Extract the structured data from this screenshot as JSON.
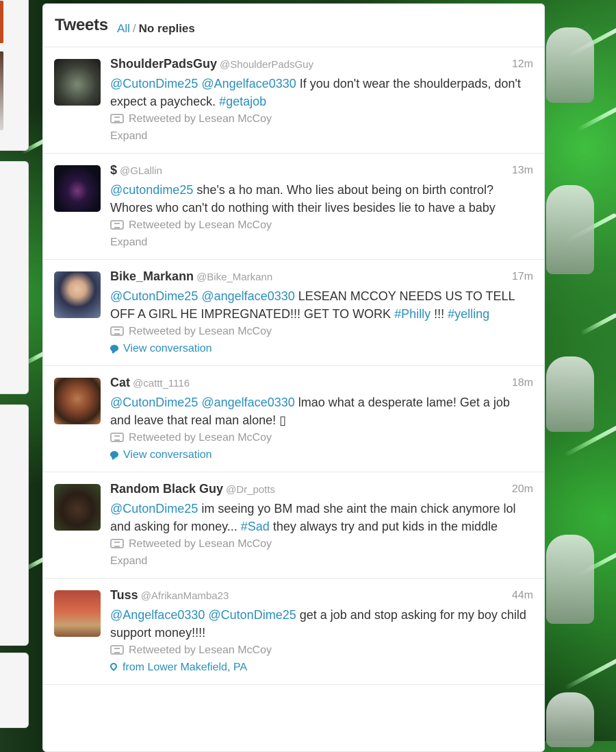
{
  "header": {
    "title": "Tweets",
    "link_all": "All",
    "separator": "/",
    "link_no_replies": "No replies"
  },
  "left_panel": {
    "close_glyph": "×"
  },
  "icons": {
    "retweet": "retweet-icon",
    "conversation": "speech-bubble-icon",
    "location": "map-pin-icon",
    "dismiss": "close-icon"
  },
  "colors": {
    "link": "#2a8fbd",
    "text": "#333333",
    "muted": "#999999"
  },
  "tweets": [
    {
      "name": "ShoulderPadsGuy",
      "handle": "@ShoulderPadsGuy",
      "time": "12m",
      "text_parts": [
        {
          "t": "@CutonDime25",
          "hl": true
        },
        {
          "t": " ",
          "hl": false
        },
        {
          "t": "@Angelface0330",
          "hl": true
        },
        {
          "t": " If you don't wear the shoulderpads, don't expect a paycheck. ",
          "hl": false
        },
        {
          "t": "#getajob",
          "hl": true
        }
      ],
      "retweeted_by": "Retweeted by Lesean McCoy",
      "action": "Expand",
      "action_type": "expand"
    },
    {
      "name": "$",
      "handle": "@GLallin",
      "time": "13m",
      "text_parts": [
        {
          "t": "@cutondime25",
          "hl": true
        },
        {
          "t": " she's a ho man. Who lies about being on birth control? Whores who can't do nothing with their lives besides lie to have a baby",
          "hl": false
        }
      ],
      "retweeted_by": "Retweeted by Lesean McCoy",
      "action": "Expand",
      "action_type": "expand"
    },
    {
      "name": "Bike_Markann",
      "handle": "@Bike_Markann",
      "time": "17m",
      "text_parts": [
        {
          "t": "@CutonDime25",
          "hl": true
        },
        {
          "t": " ",
          "hl": false
        },
        {
          "t": "@angelface0330",
          "hl": true
        },
        {
          "t": " LESEAN MCCOY NEEDS US TO TELL OFF A GIRL HE IMPREGNATED!!! GET TO WORK ",
          "hl": false
        },
        {
          "t": "#Philly",
          "hl": true
        },
        {
          "t": " !!! ",
          "hl": false
        },
        {
          "t": "#yelling",
          "hl": true
        }
      ],
      "retweeted_by": "Retweeted by Lesean McCoy",
      "action": "View conversation",
      "action_type": "conversation"
    },
    {
      "name": "Cat",
      "handle": "@cattt_1116",
      "time": "18m",
      "text_parts": [
        {
          "t": "@CutonDime25",
          "hl": true
        },
        {
          "t": " ",
          "hl": false
        },
        {
          "t": "@angelface0330",
          "hl": true
        },
        {
          "t": " lmao what a desperate lame! Get a job and leave that real man alone! ▯",
          "hl": false
        }
      ],
      "retweeted_by": "Retweeted by Lesean McCoy",
      "action": "View conversation",
      "action_type": "conversation"
    },
    {
      "name": "Random Black Guy",
      "handle": "@Dr_potts",
      "time": "20m",
      "text_parts": [
        {
          "t": "@CutonDime25",
          "hl": true
        },
        {
          "t": " im seeing yo BM mad she aint the main chick anymore lol and asking for money... ",
          "hl": false
        },
        {
          "t": "#Sad",
          "hl": true
        },
        {
          "t": " they always try and put kids in the middle",
          "hl": false
        }
      ],
      "retweeted_by": "Retweeted by Lesean McCoy",
      "action": "Expand",
      "action_type": "expand"
    },
    {
      "name": "Tuss",
      "handle": "@AfrikanMamba23",
      "time": "44m",
      "text_parts": [
        {
          "t": "@Angelface0330",
          "hl": true
        },
        {
          "t": " ",
          "hl": false
        },
        {
          "t": "@CutonDime25",
          "hl": true
        },
        {
          "t": " get a job and stop asking for my boy child support money!!!!",
          "hl": false
        }
      ],
      "retweeted_by": "Retweeted by Lesean McCoy",
      "action": "from Lower Makefield, PA",
      "action_type": "location"
    }
  ]
}
